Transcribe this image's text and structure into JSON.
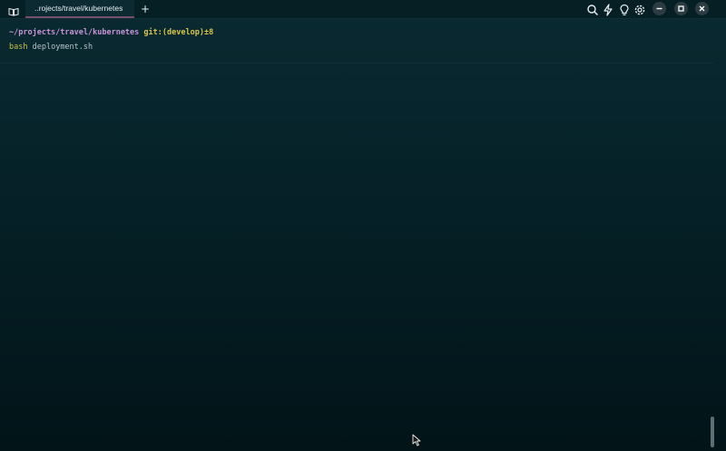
{
  "tab": {
    "title": "..rojects/travel/kubernetes"
  },
  "toolbar": {
    "new_tab_label": "+",
    "icons": [
      "search-icon",
      "lightning-icon",
      "lightbulb-icon",
      "gear-icon"
    ]
  },
  "window_controls": [
    "minimize-icon",
    "maximize-icon",
    "close-icon"
  ],
  "terminal": {
    "prompt": {
      "path": "~/projects/travel/kubernetes",
      "git_prefix": "git:(",
      "branch": "develop",
      "git_suffix": ")±8"
    },
    "command": {
      "name": "bash",
      "argument": "deployment.sh"
    }
  },
  "colors": {
    "background": "#041d23",
    "prompt_path": "#c792d6",
    "prompt_git": "#d9c54a",
    "command": "#c8c247",
    "tab_underline": "#7a4d6b"
  }
}
